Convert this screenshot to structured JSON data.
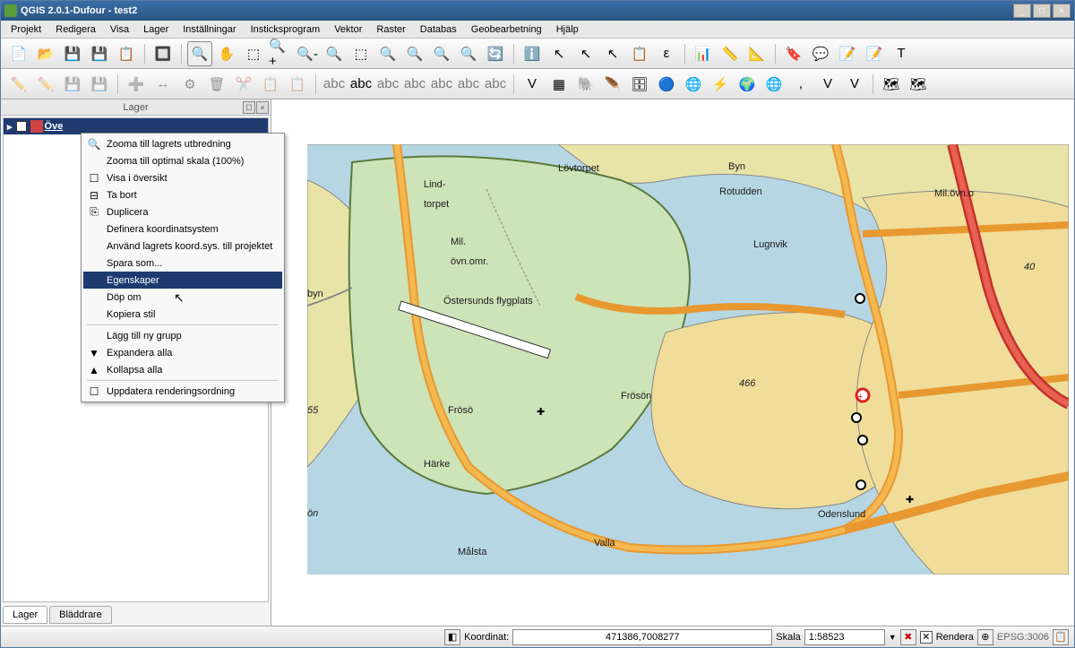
{
  "window": {
    "title": "QGIS 2.0.1-Dufour - test2"
  },
  "menu": [
    "Projekt",
    "Redigera",
    "Visa",
    "Lager",
    "Inställningar",
    "Insticksprogram",
    "Vektor",
    "Raster",
    "Databas",
    "Geobearbetning",
    "Hjälp"
  ],
  "layers_panel": {
    "title": "Lager",
    "layer_label": "Öve"
  },
  "tabs": {
    "lager": "Lager",
    "bladdrare": "Bläddrare"
  },
  "context": {
    "items": [
      "Zooma till lagrets utbredning",
      "Zooma till optimal skala (100%)",
      "Visa i översikt",
      "Ta bort",
      "Duplicera",
      "Definera koordinatsystem",
      "Använd lagrets koord.sys. till projektet",
      "Spara som...",
      "Egenskaper",
      "Döp om",
      "Kopiera stil",
      "Lägg till ny grupp",
      "Expandera alla",
      "Kollapsa alla",
      "Uppdatera renderingsordning"
    ],
    "selected_index": 8
  },
  "status": {
    "koord_label": "Koordinat:",
    "koord_value": "471386,7008277",
    "skala_label": "Skala",
    "skala_value": "1:58523",
    "rendera_label": "Rendera",
    "epsg": "EPSG:3006"
  },
  "map_labels": {
    "lindtorpet": "Lind-\ntorpet",
    "lovtorpet": "Lövtorpet",
    "byn": "Byn",
    "rotudden": "Rotudden",
    "milovn": "Mil.\növn.omr.",
    "milovno": "Mil.övn.o",
    "lugnvik": "Lugnvik",
    "ostersund": "Östersunds flygplats",
    "byn2": "byn",
    "froso": "Frösö",
    "froson": "Frösön",
    "harke": "Härke",
    "valla": "Valla",
    "odenslund": "Odenslund",
    "malsta": "Målsta",
    "elev": "466",
    "elev2": "40",
    "on": "ön",
    "fiftyfive": "55"
  }
}
